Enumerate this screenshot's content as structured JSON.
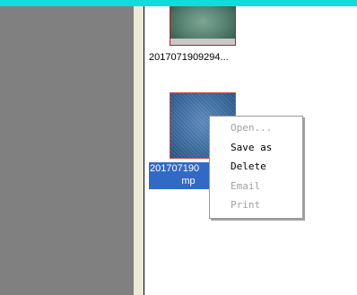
{
  "files": [
    {
      "caption_line1": "2017071909294..."
    },
    {
      "caption_line1": "201707190",
      "caption_line2": "mp"
    }
  ],
  "context_menu": {
    "items": [
      {
        "label": "Open...",
        "enabled": false
      },
      {
        "label": "Save as",
        "enabled": true
      },
      {
        "label": "Delete",
        "enabled": true
      },
      {
        "label": "Email",
        "enabled": false
      },
      {
        "label": "Print",
        "enabled": false
      }
    ]
  },
  "colors": {
    "title_bar": "#10dcdc",
    "left_pane": "#808080",
    "selection": "#316ac5",
    "thumbnail_border": "#b82020"
  }
}
